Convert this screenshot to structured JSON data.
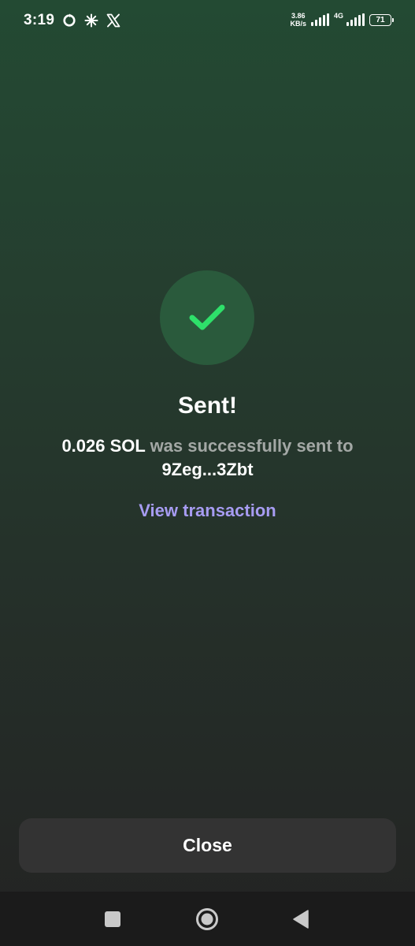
{
  "status_bar": {
    "time": "3:19",
    "net_speed_value": "3.86",
    "net_speed_unit": "KB/s",
    "network_type": "4G",
    "battery": "71",
    "left_icons": [
      "sync-icon",
      "pinwheel-icon",
      "x-logo-icon"
    ]
  },
  "result": {
    "icon": "checkmark-icon",
    "title": "Sent!",
    "amount": "0.026 SOL",
    "message": "was successfully sent to",
    "address": "9Zeg...3Zbt",
    "view_link": "View transaction"
  },
  "actions": {
    "close_label": "Close"
  },
  "nav_bar": {
    "buttons": [
      "recents-square-icon",
      "home-circle-icon",
      "back-triangle-icon"
    ]
  },
  "colors": {
    "accent_check": "#2ee06a",
    "link": "#a79cf2",
    "muted_text": "#a3a8a5",
    "success_circle": "#2a5a3c",
    "button_bg": "#333333"
  }
}
